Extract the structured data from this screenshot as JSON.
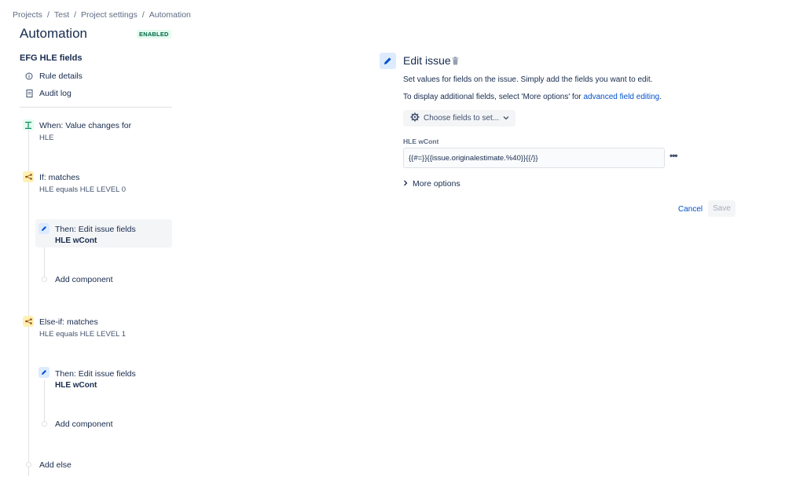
{
  "breadcrumb": [
    "Projects",
    "Test",
    "Project settings",
    "Automation"
  ],
  "header": {
    "title": "Automation",
    "status": "ENABLED"
  },
  "sidebar": {
    "rule_name": "EFG HLE fields",
    "links": [
      {
        "label": "Rule details",
        "icon": "info-icon"
      },
      {
        "label": "Audit log",
        "icon": "document-icon"
      }
    ]
  },
  "timeline": {
    "trigger": {
      "title": "When: Value changes for",
      "sub": "HLE"
    },
    "if_block": {
      "title": "If: matches",
      "sub": "HLE equals HLE LEVEL 0"
    },
    "then1": {
      "title": "Then: Edit issue fields",
      "sub": "HLE wCont"
    },
    "add1": "Add component",
    "elseif_block": {
      "title": "Else-if: matches",
      "sub": "HLE equals HLE LEVEL 1"
    },
    "then2": {
      "title": "Then: Edit issue fields",
      "sub": "HLE wCont"
    },
    "add2": "Add component",
    "add_else": "Add else"
  },
  "panel": {
    "title": "Edit issue",
    "desc1": "Set values for fields on the issue. Simply add the fields you want to edit.",
    "desc2_prefix": "To display additional fields, select 'More options' for ",
    "desc2_link": "advanced field editing",
    "desc2_suffix": ".",
    "choose_label": "Choose fields to set...",
    "field_label": "HLE wCont",
    "field_value": "{{#=}}{{issue.originalestimate.%40}}{{/}}",
    "more_options": "More options",
    "cancel": "Cancel",
    "save": "Save"
  }
}
